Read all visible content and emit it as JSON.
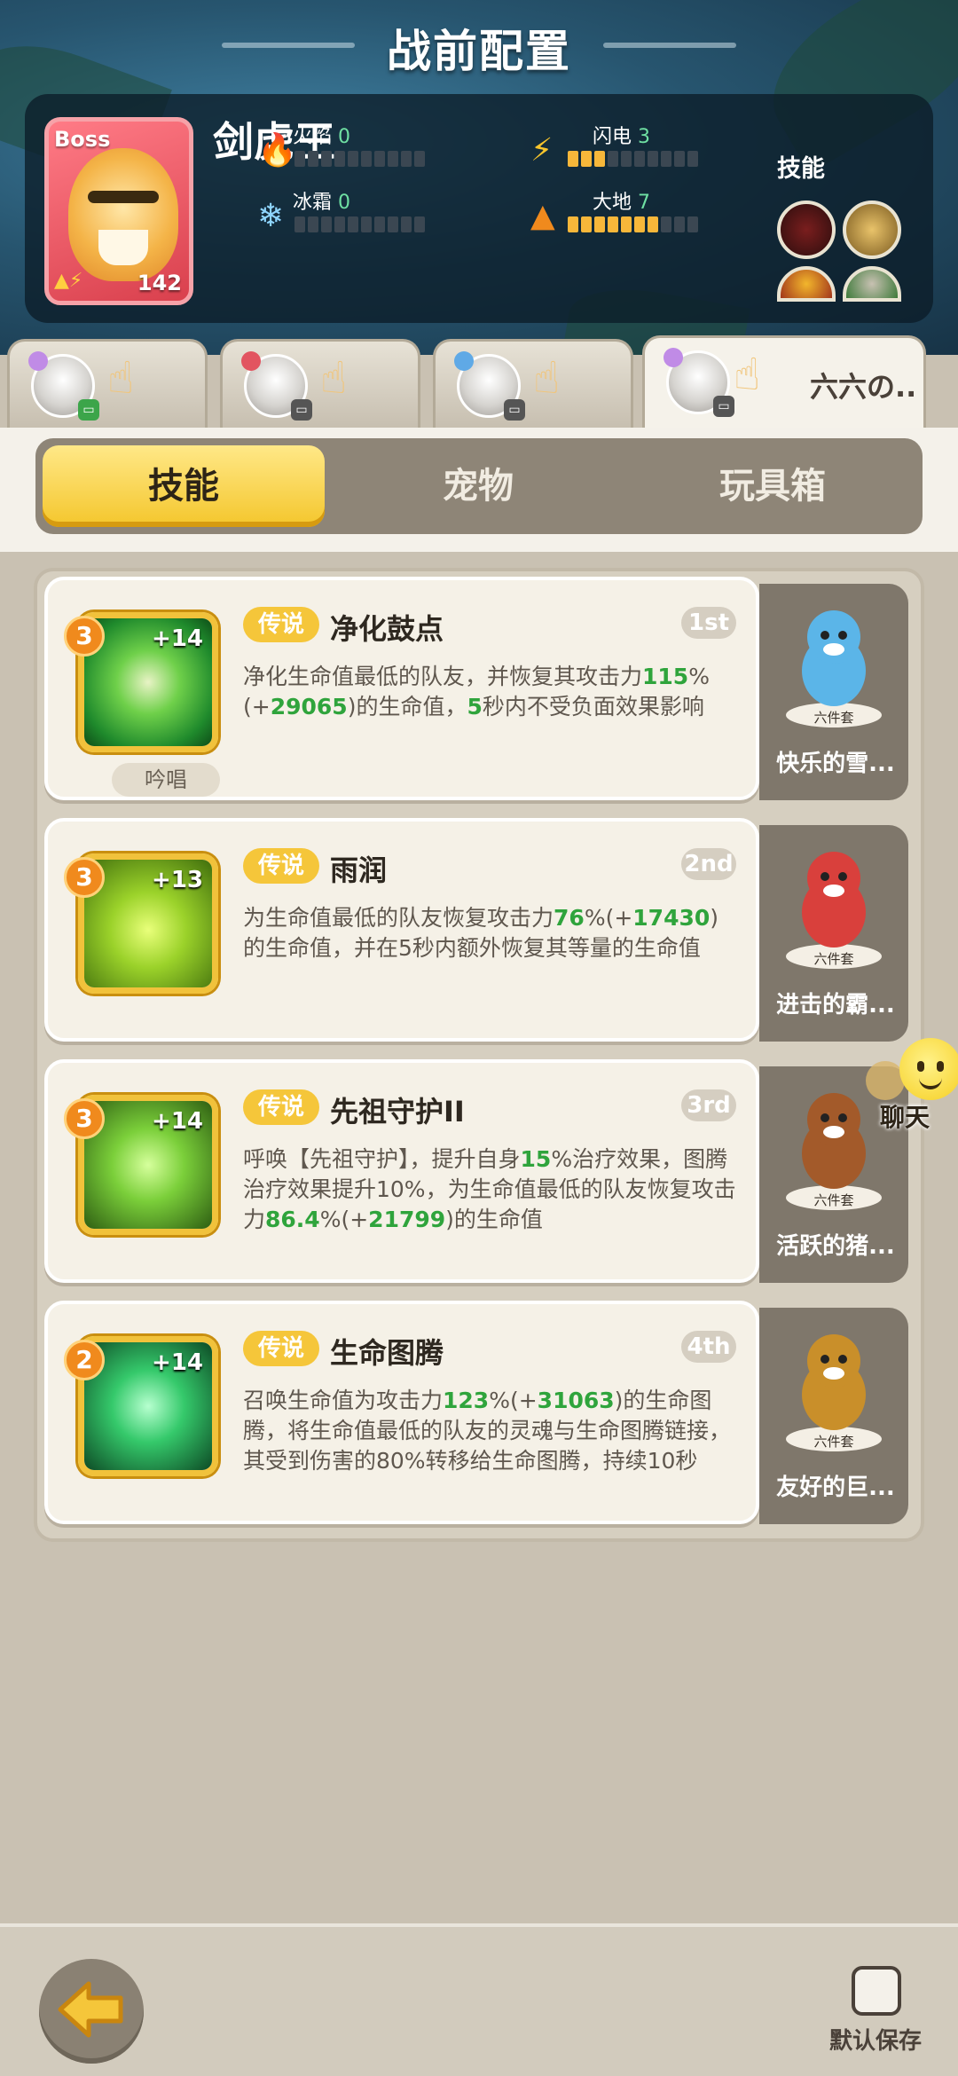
{
  "header": {
    "title": "战前配置"
  },
  "boss": {
    "tag": "Boss",
    "name": "剑虎王",
    "level": "142",
    "stats": [
      {
        "label": "火焰",
        "value": "0",
        "icon": "fire-icon",
        "filled": 0
      },
      {
        "label": "闪电",
        "value": "3",
        "icon": "lightning-icon",
        "filled": 3
      },
      {
        "label": "冰霜",
        "value": "0",
        "icon": "snowflake-icon",
        "filled": 0
      },
      {
        "label": "大地",
        "value": "7",
        "icon": "earth-icon",
        "filled": 7
      }
    ],
    "skills_label": "技能"
  },
  "players": [
    {
      "name": "",
      "icon": "avatar"
    },
    {
      "name": "",
      "icon": "avatar"
    },
    {
      "name": "",
      "icon": "avatar"
    },
    {
      "name": "六六の..",
      "icon": "avatar"
    }
  ],
  "section_tabs": [
    "技能",
    "宠物",
    "玩具箱"
  ],
  "skills": [
    {
      "level": "3",
      "plus": "+14",
      "rarity": "传说",
      "name": "净化鼓点",
      "rank": "1st",
      "tag": "吟唱",
      "desc_parts": [
        {
          "t": "净化生命值最低的队友，并恢复其攻击力",
          "g": false
        },
        {
          "t": "115",
          "g": true
        },
        {
          "t": "%(+",
          "g": false
        },
        {
          "t": "29065",
          "g": true
        },
        {
          "t": ")的生命值，",
          "g": false
        },
        {
          "t": "5",
          "g": true
        },
        {
          "t": "秒内不受负面效果影响",
          "g": false
        }
      ],
      "pet": {
        "set": "六件套",
        "name": "快乐的雪..."
      }
    },
    {
      "level": "3",
      "plus": "+13",
      "rarity": "传说",
      "name": "雨润",
      "rank": "2nd",
      "tag": "",
      "desc_parts": [
        {
          "t": "为生命值最低的队友恢复攻击力",
          "g": false
        },
        {
          "t": "76",
          "g": true
        },
        {
          "t": "%(+",
          "g": false
        },
        {
          "t": "17430",
          "g": true
        },
        {
          "t": ")的生命值，并在5秒内额外恢复其等量的生命值",
          "g": false
        }
      ],
      "pet": {
        "set": "六件套",
        "name": "进击的霸..."
      }
    },
    {
      "level": "3",
      "plus": "+14",
      "rarity": "传说",
      "name": "先祖守护II",
      "rank": "3rd",
      "tag": "",
      "desc_parts": [
        {
          "t": "呼唤【先祖守护】，提升自身",
          "g": false
        },
        {
          "t": "15",
          "g": true
        },
        {
          "t": "%治疗效果，图腾治疗效果提升10%，为生命值最低的队友恢复攻击力",
          "g": false
        },
        {
          "t": "86.4",
          "g": true
        },
        {
          "t": "%(+",
          "g": false
        },
        {
          "t": "21799",
          "g": true
        },
        {
          "t": ")的生命值",
          "g": false
        }
      ],
      "pet": {
        "set": "六件套",
        "name": "活跃的猪..."
      }
    },
    {
      "level": "2",
      "plus": "+14",
      "rarity": "传说",
      "name": "生命图腾",
      "rank": "4th",
      "tag": "",
      "desc_parts": [
        {
          "t": "召唤生命值为攻击力",
          "g": false
        },
        {
          "t": "123",
          "g": true
        },
        {
          "t": "%(+",
          "g": false
        },
        {
          "t": "31063",
          "g": true
        },
        {
          "t": ")的生命图腾，将生命值最低的队友的灵魂与生命图腾链接，其受到伤害的80%转移给生命图腾，持续10秒",
          "g": false
        }
      ],
      "pet": {
        "set": "六件套",
        "name": "友好的巨..."
      }
    }
  ],
  "chat": {
    "label": "聊天"
  },
  "footer": {
    "save_label": "默认保存"
  },
  "colors": {
    "accent": "#f4c62b",
    "highlight": "#2fa43c",
    "boss_card": "#e25460"
  }
}
